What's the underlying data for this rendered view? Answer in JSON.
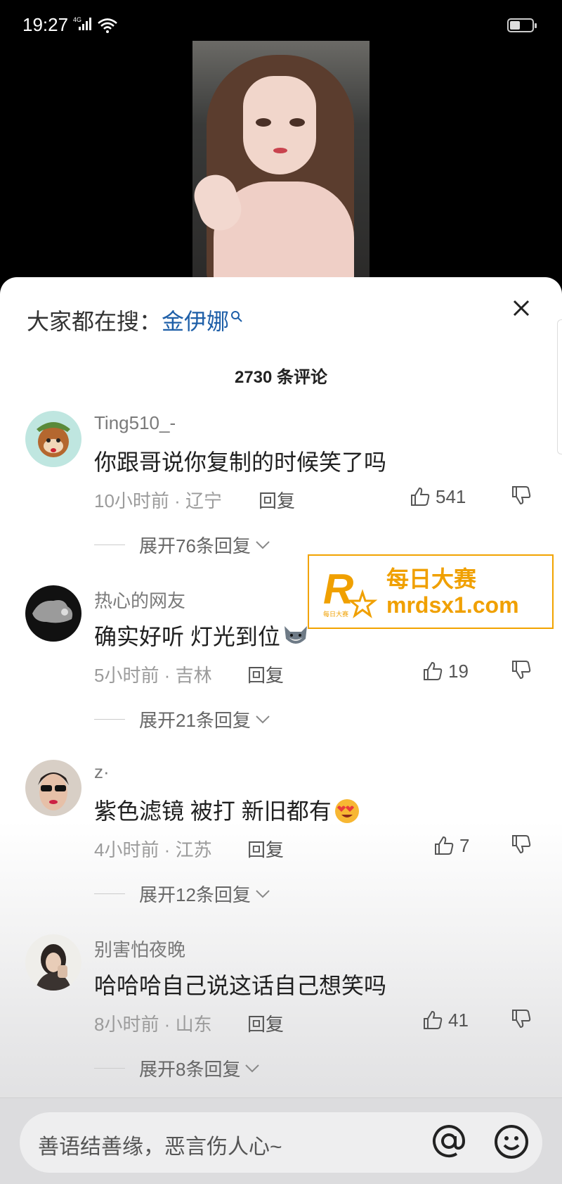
{
  "status_bar": {
    "time": "19:27",
    "network": "4G"
  },
  "search": {
    "prefix": "大家都在搜：",
    "keyword": "金伊娜"
  },
  "comments_header": "2730 条评论",
  "comments": [
    {
      "user": "Ting510_-",
      "text": "你跟哥说你复制的时候笑了吗",
      "emoji": "",
      "time_loc": "10小时前 · 辽宁",
      "reply_label": "回复",
      "likes": "541",
      "expand": "展开76条回复"
    },
    {
      "user": "热心的网友",
      "text": "确实好听 灯光到位",
      "emoji": "wolf-emoji",
      "time_loc": "5小时前 · 吉林",
      "reply_label": "回复",
      "likes": "19",
      "expand": "展开21条回复"
    },
    {
      "user": "z·",
      "text": "紫色滤镜 被打 新旧都有",
      "emoji": "heart-eyes-emoji",
      "time_loc": "4小时前 · 江苏",
      "reply_label": "回复",
      "likes": "7",
      "expand": "展开12条回复"
    },
    {
      "user": "别害怕夜晚",
      "text": "哈哈哈自己说这话自己想笑吗",
      "emoji": "",
      "time_loc": "8小时前 · 山东",
      "reply_label": "回复",
      "likes": "41",
      "expand": "展开8条回复"
    }
  ],
  "watermark": {
    "cn": "每日大赛",
    "url": "mrdsx1.com",
    "logo_letter": "R",
    "logo_small": "每日大赛"
  },
  "input": {
    "placeholder": "善语结善缘，恶言伤人心~"
  },
  "colors": {
    "keyword": "#1e5fa8",
    "watermark": "#f0a000"
  }
}
